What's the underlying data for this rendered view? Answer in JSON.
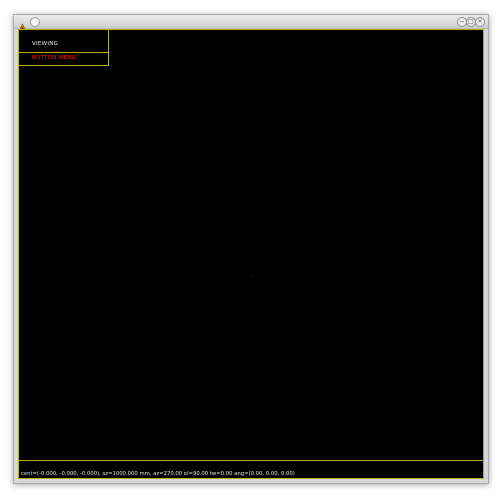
{
  "window": {
    "controls": {
      "minimize": "−",
      "maximize": "□",
      "close": "×"
    }
  },
  "menu": {
    "title": "VIEWING",
    "button_menu_label": "BUTTON MENU"
  },
  "status": {
    "text": "cent=(-0.000, -0.000, -0.000), sz=1000.000 mm, az=270.00 el=90.00 tw=0.00 ang=(0.00, 0.00, 0.00)"
  },
  "colors": {
    "background": "#000000",
    "border_accent": "#b7b300",
    "menu_title": "#e8e8e8",
    "menu_button": "#ff1a1a",
    "status_text": "#e6e6e6"
  },
  "icons": {
    "app": "app-logo-icon",
    "menu": "window-menu-icon"
  }
}
